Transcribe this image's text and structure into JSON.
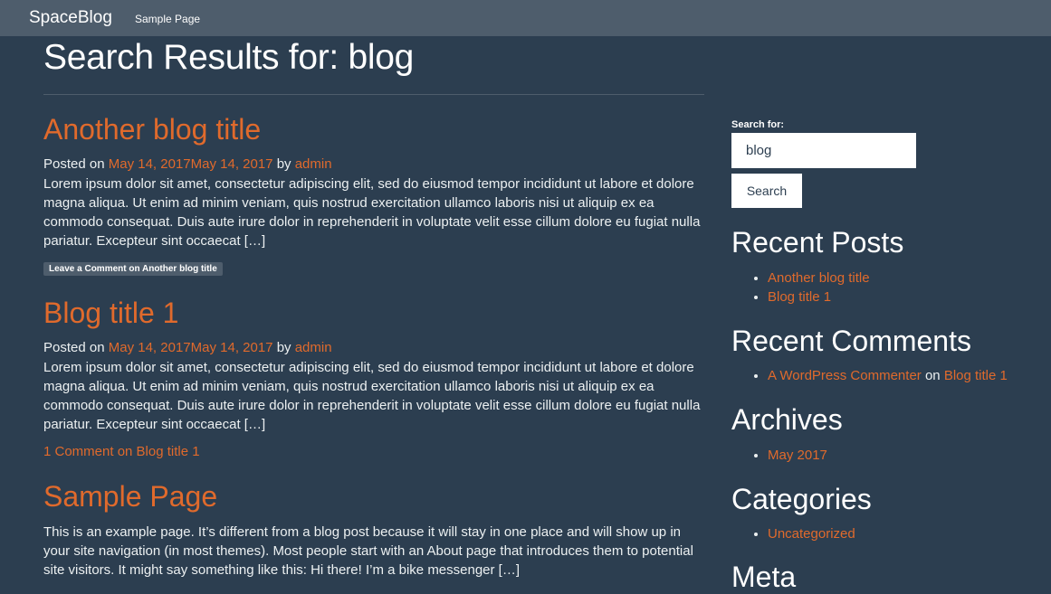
{
  "header": {
    "brand": "SpaceBlog",
    "nav": [
      "Sample Page"
    ]
  },
  "main": {
    "page_title": "Search Results for: blog",
    "posts": [
      {
        "title": "Another blog title",
        "meta_prefix": "Posted on",
        "date": "May 14, 2017May 14, 2017",
        "by": "by",
        "author": "admin",
        "excerpt": "Lorem ipsum dolor sit amet, consectetur adipiscing elit, sed do eiusmod tempor incididunt ut labore et dolore magna aliqua. Ut enim ad minim veniam, quis nostrud exercitation ullamco laboris nisi ut aliquip ex ea commodo consequat. Duis aute irure dolor in reprehenderit in voluptate velit esse cillum dolore eu fugiat nulla pariatur. Excepteur sint occaecat […]",
        "comment_link": "Leave a Comment on Another blog title"
      },
      {
        "title": "Blog title 1",
        "meta_prefix": "Posted on",
        "date": "May 14, 2017May 14, 2017",
        "by": "by",
        "author": "admin",
        "excerpt": "Lorem ipsum dolor sit amet, consectetur adipiscing elit, sed do eiusmod tempor incididunt ut labore et dolore magna aliqua. Ut enim ad minim veniam, quis nostrud exercitation ullamco laboris nisi ut aliquip ex ea commodo consequat. Duis aute irure dolor in reprehenderit in voluptate velit esse cillum dolore eu fugiat nulla pariatur. Excepteur sint occaecat […]",
        "comment_link": "1 Comment on Blog title 1"
      },
      {
        "title": "Sample Page",
        "excerpt": "This is an example page. It’s different from a blog post because it will stay in one place and will show up in your site navigation (in most themes). Most people start with an About page that introduces them to potential site visitors. It might say something like this: Hi there! I’m a bike messenger […]"
      }
    ]
  },
  "sidebar": {
    "search": {
      "label": "Search for:",
      "value": "blog",
      "button": "Search"
    },
    "recent_posts": {
      "title": "Recent Posts",
      "items": [
        "Another blog title",
        "Blog title 1"
      ]
    },
    "recent_comments": {
      "title": "Recent Comments",
      "author": "A WordPress Commenter",
      "on": "on",
      "post": "Blog title 1"
    },
    "archives": {
      "title": "Archives",
      "items": [
        "May 2017"
      ]
    },
    "categories": {
      "title": "Categories",
      "items": [
        "Uncategorized"
      ]
    },
    "meta": {
      "title": "Meta"
    }
  },
  "colors": {
    "background": "#2c3e50",
    "navbar": "#4e5d6c",
    "accent": "#e06a2c",
    "text": "#ecf0f1"
  }
}
